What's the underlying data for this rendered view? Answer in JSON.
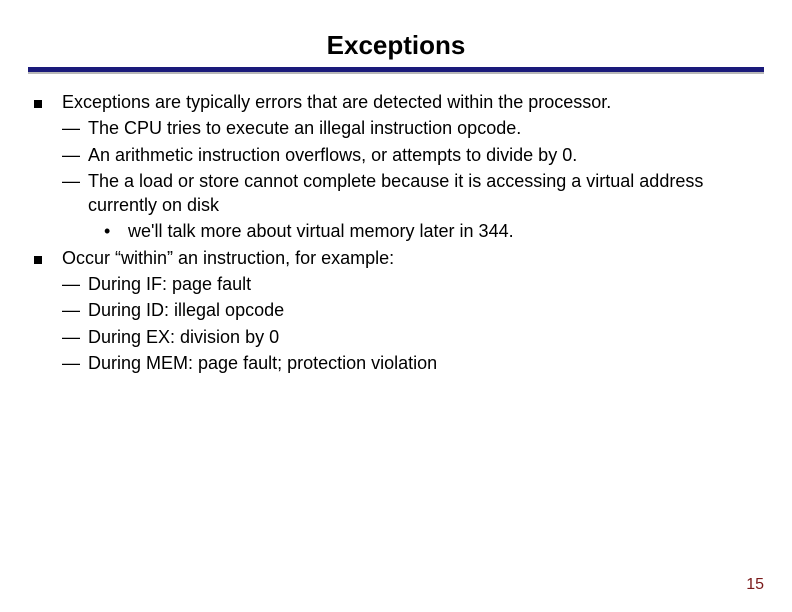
{
  "title": "Exceptions",
  "bullets": {
    "b1": "Exceptions are typically errors that are detected within the processor.",
    "b1a": "The CPU tries to execute an illegal instruction opcode.",
    "b1b": "An arithmetic instruction overflows, or attempts to divide by 0.",
    "b1c": "The a load or store cannot complete because it is accessing a virtual address currently on disk",
    "b1c_i": "we'll talk more about virtual memory later in 344.",
    "b2": "Occur “within” an instruction, for example:",
    "b2a": "During IF: page fault",
    "b2b": "During ID: illegal opcode",
    "b2c": "During EX: division by 0",
    "b2d": "During MEM: page fault; protection violation"
  },
  "page_number": "15"
}
